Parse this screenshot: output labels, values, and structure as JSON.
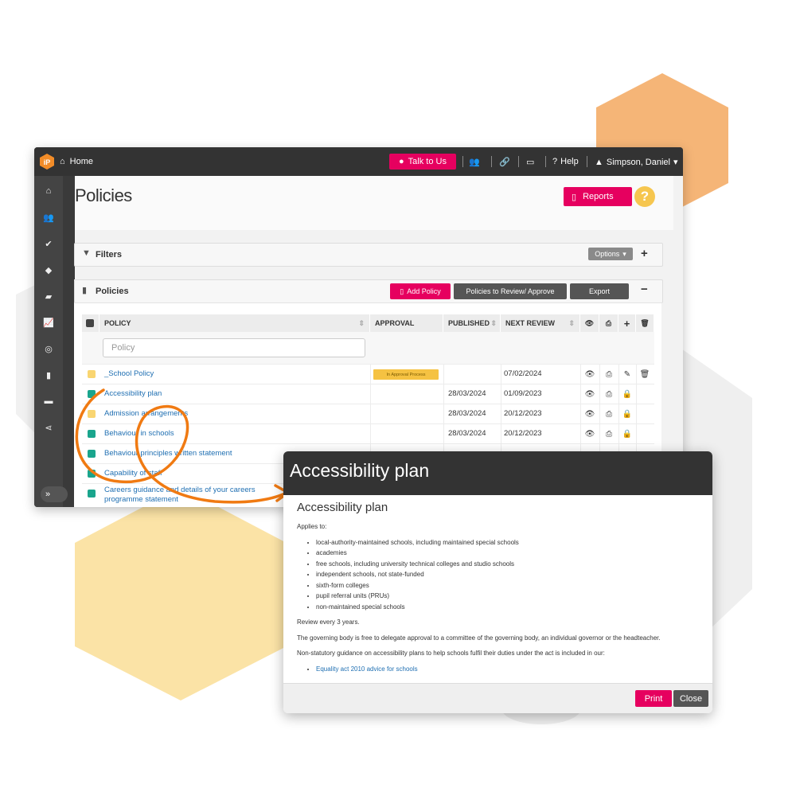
{
  "colors": {
    "accent": "#e6005f",
    "topbar": "#333333",
    "hex_orange": "#f5b577",
    "hex_yellow": "#fbe3a6",
    "link": "#1f6fb2",
    "status_yellow": "#f9d571",
    "status_teal": "#1aa58d"
  },
  "topbar": {
    "logo": "iP",
    "home_label": "Home",
    "talk_label": "Talk to Us",
    "help_label": "Help",
    "user_label": "Simpson, Daniel",
    "icons": [
      "home-icon",
      "chat-icon",
      "users-icon",
      "link-icon",
      "inbox-icon",
      "question-icon",
      "user-icon",
      "caret-down-icon"
    ]
  },
  "sidebar": {
    "icons": [
      "home-icon",
      "users-icon",
      "check-icon",
      "tag-icon",
      "book-icon",
      "chart-icon",
      "target-icon",
      "file-icon",
      "folder-icon",
      "share-icon"
    ],
    "expand_label": "»"
  },
  "page": {
    "title": "Policies",
    "reports_label": "Reports",
    "help_badge": "?"
  },
  "filters": {
    "title": "Filters",
    "options_label": "Options",
    "add": "+"
  },
  "policies_panel": {
    "title": "Policies",
    "add_policy_label": "Add Policy",
    "review_label": "Policies to Review/ Approve",
    "export_label": "Export",
    "collapse": "−"
  },
  "table": {
    "headers": {
      "policy": "POLICY",
      "approval": "APPROVAL",
      "published": "PUBLISHED",
      "next_review": "NEXT REVIEW"
    },
    "search_placeholder": "Policy",
    "rows": [
      {
        "name": "_School Policy",
        "status": "yellow",
        "approval": "In Approval Process",
        "published": "",
        "next_review": "07/02/2024",
        "action": "edit"
      },
      {
        "name": "Accessibility plan",
        "status": "teal",
        "approval": "",
        "published": "28/03/2024",
        "next_review": "01/09/2023",
        "action": "lock"
      },
      {
        "name": "Admission arrangements",
        "status": "yellow",
        "approval": "",
        "published": "28/03/2024",
        "next_review": "20/12/2023",
        "action": "lock"
      },
      {
        "name": "Behaviour in schools",
        "status": "teal",
        "approval": "",
        "published": "28/03/2024",
        "next_review": "20/12/2023",
        "action": "lock"
      },
      {
        "name": "Behaviour principles written statement",
        "status": "teal",
        "approval": "",
        "published": "",
        "next_review": "",
        "action": ""
      },
      {
        "name": "Capability of staff",
        "status": "teal",
        "approval": "",
        "published": "",
        "next_review": "",
        "action": ""
      },
      {
        "name": "Careers guidance and details of your careers programme statement",
        "status": "teal",
        "approval": "",
        "published": "",
        "next_review": "",
        "action": ""
      }
    ]
  },
  "modal": {
    "header_title": "Accessibility plan",
    "heading": "Accessibility plan",
    "applies_to": "Applies to:",
    "applies_list": [
      "local-authority-maintained schools, including maintained special schools",
      "academies",
      "free schools, including university technical colleges and studio schools",
      "independent schools, not state-funded",
      "sixth-form colleges",
      "pupil referral units (PRUs)",
      "non-maintained special schools"
    ],
    "review": "Review every 3 years.",
    "delegate": "The governing body is free to delegate approval to a committee of the governing body, an individual governor or the headteacher.",
    "guidance": "Non-statutory guidance on accessibility plans to help schools fulfil their duties under the act is included in our:",
    "link": "Equality act 2010 advice for schools",
    "print_label": "Print",
    "close_label": "Close"
  }
}
